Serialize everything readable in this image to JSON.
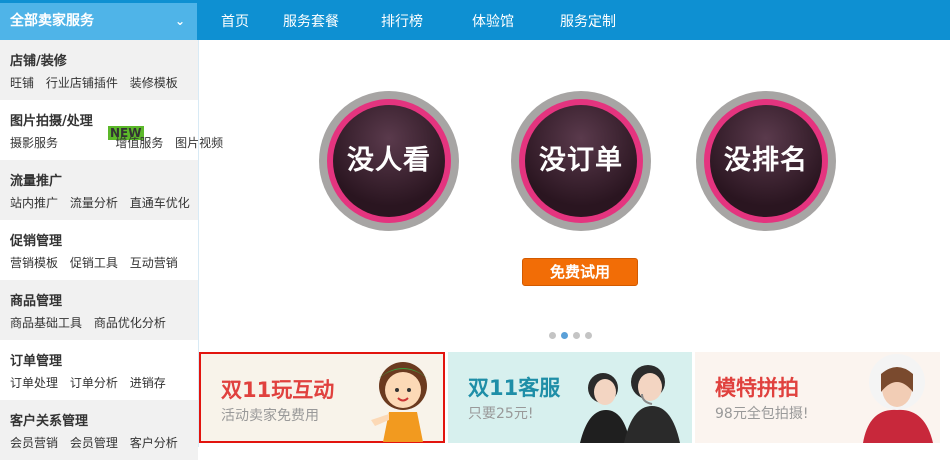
{
  "header": {
    "all_services": "全部卖家服务",
    "nav": [
      "首页",
      "服务套餐",
      "排行榜",
      "体验馆",
      "服务定制"
    ]
  },
  "sidebar": {
    "categories": [
      {
        "title": "店铺/装修",
        "links": [
          "旺铺",
          "行业店铺插件",
          "装修模板"
        ]
      },
      {
        "title": "图片拍摄/处理",
        "links": [
          "摄影服务",
          "增值服务",
          "图片视频"
        ],
        "badge": "NEW"
      },
      {
        "title": "流量推广",
        "links": [
          "站内推广",
          "流量分析",
          "直通车优化"
        ]
      },
      {
        "title": "促销管理",
        "links": [
          "营销模板",
          "促销工具",
          "互动营销"
        ]
      },
      {
        "title": "商品管理",
        "links": [
          "商品基础工具",
          "商品优化分析"
        ]
      },
      {
        "title": "订单管理",
        "links": [
          "订单处理",
          "订单分析",
          "进销存"
        ]
      },
      {
        "title": "客户关系管理",
        "links": [
          "会员营销",
          "会员管理",
          "客户分析"
        ]
      }
    ]
  },
  "hero": {
    "circles": [
      "没人看",
      "没订单",
      "没排名"
    ],
    "cta": "免费试用",
    "slide_count": 4,
    "active_slide": 2
  },
  "banners": [
    {
      "heading": "双11玩互动",
      "sub": "活动卖家免费用"
    },
    {
      "heading": "双11客服",
      "sub": "只要25元!"
    },
    {
      "heading": "模特拼拍",
      "sub": "98元全包拍摄!"
    }
  ]
}
